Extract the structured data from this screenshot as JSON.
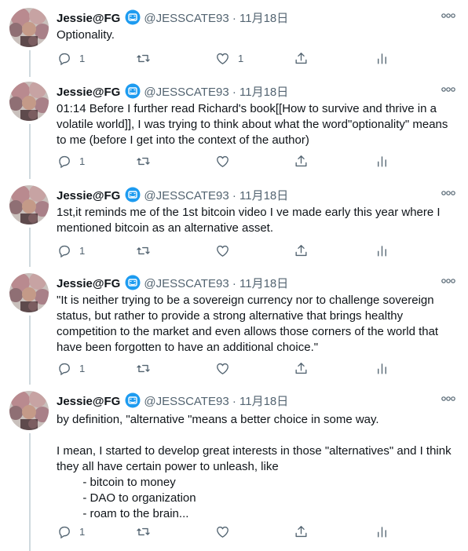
{
  "tweets": [
    {
      "name": "Jessie@FG",
      "handle": "@JESSCATE93",
      "sep": "·",
      "date": "11月18日",
      "text": "Optionality.",
      "reply_count": "1",
      "retweet_count": "",
      "like_count": "1"
    },
    {
      "name": "Jessie@FG",
      "handle": "@JESSCATE93",
      "sep": "·",
      "date": "11月18日",
      "text": "01:14 Before I further read Richard's book[[How to survive and thrive in a volatile world]], I was trying to think about what the word\"optionality\" means to me (before I get into the context of the author)",
      "reply_count": "1",
      "retweet_count": "",
      "like_count": ""
    },
    {
      "name": "Jessie@FG",
      "handle": "@JESSCATE93",
      "sep": "·",
      "date": "11月18日",
      "text": "1st,it reminds me of the 1st bitcoin video I ve made early this year where I mentioned bitcoin as an alternative asset.",
      "reply_count": "1",
      "retweet_count": "",
      "like_count": ""
    },
    {
      "name": "Jessie@FG",
      "handle": "@JESSCATE93",
      "sep": "·",
      "date": "11月18日",
      "text": "\"It is neither trying to be a sovereign currency nor to challenge sovereign status, but rather to provide a strong alternative that brings healthy competition to the market and even allows those corners of the world that have been forgotten to have an additional choice.\"",
      "reply_count": "1",
      "retweet_count": "",
      "like_count": ""
    },
    {
      "name": "Jessie@FG",
      "handle": "@JESSCATE93",
      "sep": "·",
      "date": "11月18日",
      "text": "by definition, \"alternative \"means a better choice in some way.\n\nI mean, I started to develop great interests in those \"alternatives\" and I think they all have certain power to unleash, like\n        - bitcoin to money\n        - DAO to organization\n        - roam to the brain...",
      "reply_count": "1",
      "retweet_count": "",
      "like_count": ""
    }
  ],
  "icons": {
    "verified": "emoji-badge-icon",
    "more": "more-icon",
    "reply": "reply-icon",
    "retweet": "retweet-icon",
    "like": "heart-icon",
    "share": "share-icon",
    "analytics": "analytics-icon"
  },
  "colors": {
    "text": "#0f1419",
    "secondary": "#536471",
    "badge": "#1d9bf0",
    "thread_line": "#cfd9de"
  }
}
